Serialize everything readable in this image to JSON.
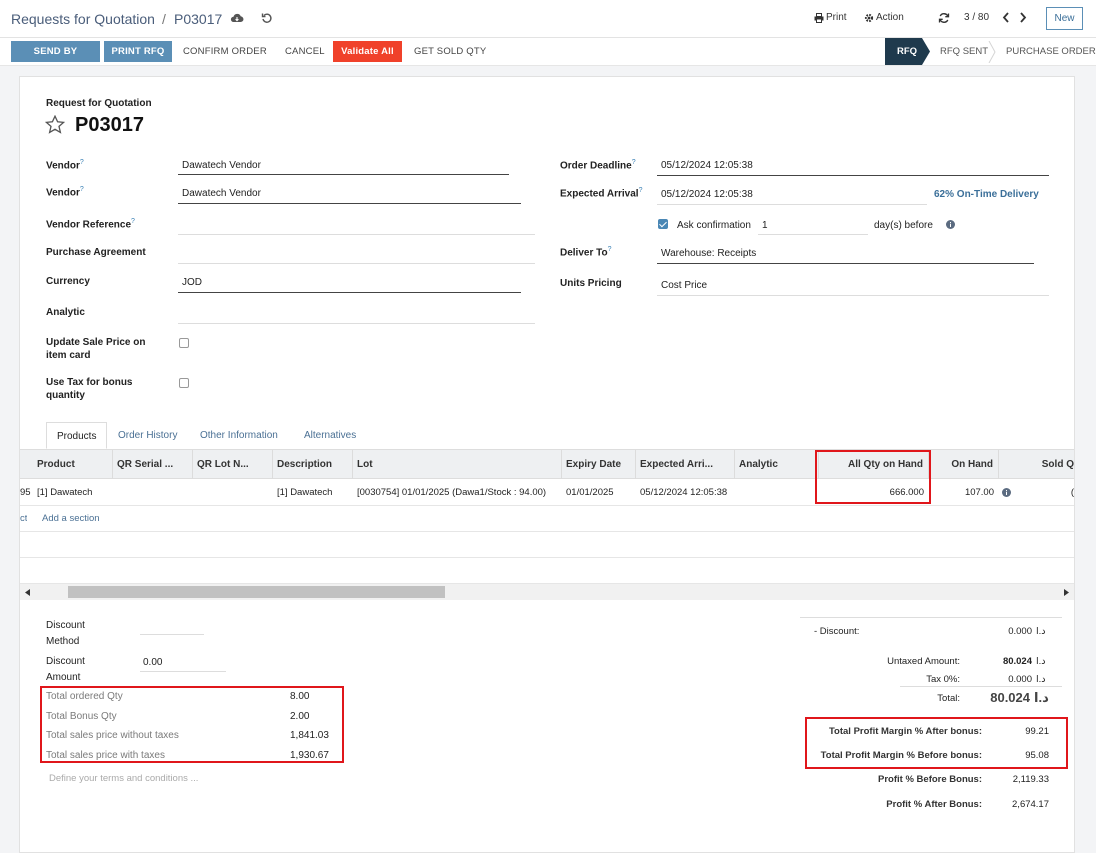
{
  "breadcrumb": {
    "parent": "Requests for Quotation",
    "sep": "/",
    "current": "P03017"
  },
  "toolbar": {
    "print": "Print",
    "action": "Action",
    "pager": "3 / 80",
    "new": "New"
  },
  "actions": {
    "send_email": "SEND BY EMAIL",
    "print_rfq": "PRINT RFQ",
    "confirm": "CONFIRM ORDER",
    "cancel": "CANCEL",
    "validate_all": "Validate All",
    "get_sold_qty": "GET SOLD QTY"
  },
  "status": {
    "rfq": "RFQ",
    "rfq_sent": "RFQ SENT",
    "purchase_order": "PURCHASE ORDER"
  },
  "form": {
    "subtitle": "Request for Quotation",
    "name": "P03017",
    "vendor_label": "Vendor",
    "vendor_value": "Dawatech Vendor",
    "vendor2_label": "Vendor",
    "vendor2_value": "Dawatech Vendor",
    "vendor_ref_label": "Vendor Reference",
    "purchase_agreement_label": "Purchase Agreement",
    "currency_label": "Currency",
    "currency_value": "JOD",
    "analytic_label": "Analytic",
    "update_sale_label_1": "Update Sale Price on",
    "update_sale_label_2": "item card",
    "use_tax_label_1": "Use Tax for bonus",
    "use_tax_label_2": "quantity",
    "order_deadline_label": "Order Deadline",
    "order_deadline_value": "05/12/2024 12:05:38",
    "expected_arrival_label": "Expected Arrival",
    "expected_arrival_value": "05/12/2024 12:05:38",
    "on_time": "62% On-Time Delivery",
    "ask_confirmation_label": "Ask confirmation",
    "ask_confirmation_days": "1",
    "days_before": "day(s) before",
    "deliver_to_label": "Deliver To",
    "deliver_to_value": "Warehouse: Receipts",
    "units_pricing_label": "Units Pricing",
    "units_pricing_value": "Cost Price",
    "help_mark": "?"
  },
  "tabs": [
    "Products",
    "Order History",
    "Other Information",
    "Alternatives"
  ],
  "table": {
    "headers": [
      "Product",
      "QR Serial ...",
      "QR Lot N...",
      "Description",
      "Lot",
      "Expiry Date",
      "Expected Arri...",
      "Analytic",
      "All Qty on Hand",
      "On Hand",
      "Sold Q"
    ],
    "row": {
      "seq": "95",
      "product": "[1] Dawatech",
      "description": "[1] Dawatech",
      "lot": "[0030754] 01/01/2025 (Dawa1/Stock : 94.00)",
      "expiry": "01/01/2025",
      "expected": "05/12/2024 12:05:38",
      "all_qty": "666.000",
      "on_hand": "107.00",
      "sold": "("
    },
    "add_product_tail": "ct",
    "add_section": "Add a section"
  },
  "left_summary": {
    "discount_method_1": "Discount",
    "discount_method_2": "Method",
    "discount_amount_1": "Discount",
    "discount_amount_2": "Amount",
    "discount_amount_value": "0.00",
    "rows": [
      {
        "label": "Total ordered Qty",
        "value": "8.00"
      },
      {
        "label": "Total Bonus Qty",
        "value": "2.00"
      },
      {
        "label": "Total sales price without taxes",
        "value": "1,841.03"
      },
      {
        "label": "Total sales price with taxes",
        "value": "1,930.67"
      }
    ],
    "terms_placeholder": "Define your terms and conditions ..."
  },
  "right_summary": {
    "discount_label": "- Discount:",
    "discount_value": "0.000",
    "untaxed_label": "Untaxed Amount:",
    "untaxed_value": "80.024",
    "tax_label": "Tax 0%:",
    "tax_value": "0.000",
    "total_label": "Total:",
    "total_value": "80.024",
    "currency_symbol": "د.ا",
    "margin_after_label": "Total Profit Margin % After bonus:",
    "margin_after_value": "99.21",
    "margin_before_label": "Total Profit Margin % Before bonus:",
    "margin_before_value": "95.08",
    "profit_before_label": "Profit % Before Bonus:",
    "profit_before_value": "2,119.33",
    "profit_after_label": "Profit % After Bonus:",
    "profit_after_value": "2,674.17"
  },
  "colors": {
    "accent": "#5b8fb6",
    "danger": "#f0412a",
    "highlight": "#e0161b",
    "status_active": "#1f3a4d"
  }
}
